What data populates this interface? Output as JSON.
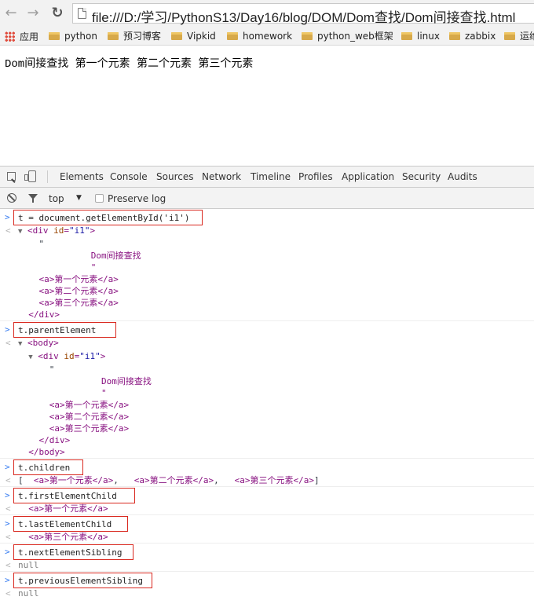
{
  "browser": {
    "url": "file:///D:/学习/PythonS13/Day16/blog/DOM/Dom查找/Dom间接查找.html",
    "bookmarks": [
      "应用",
      "python",
      "预习博客",
      "Vipkid",
      "homework",
      "python_web框架",
      "linux",
      "zabbix",
      "运维"
    ]
  },
  "page": {
    "text": "Dom间接查找 第一个元素 第二个元素 第三个元素"
  },
  "devtools": {
    "tabs": [
      "Elements",
      "Console",
      "Sources",
      "Network",
      "Timeline",
      "Profiles",
      "Application",
      "Security",
      "Audits"
    ],
    "active_tab": "Console",
    "context": "top",
    "preserve_log_label": "Preserve log"
  },
  "console": {
    "cmd1": "t = document.getElementById('i1')",
    "cmd2": "t.parentElement",
    "cmd3": "t.children",
    "cmd4": "t.firstElementChild",
    "cmd5": "t.lastElementChild",
    "cmd6": "t.nextElementSibling",
    "cmd7": "t.previousElementSibling",
    "text_dom": "Dom间接查找",
    "quote": "\"",
    "item1": "第一个元素",
    "item2": "第二个元素",
    "item3": "第三个元素",
    "null_value": "null",
    "div_id": "\"i1\""
  },
  "colors": {
    "tag": "#881280",
    "attr_name": "#994500",
    "attr_value": "#1a1aa6",
    "highlight_box": "#d9281f"
  }
}
